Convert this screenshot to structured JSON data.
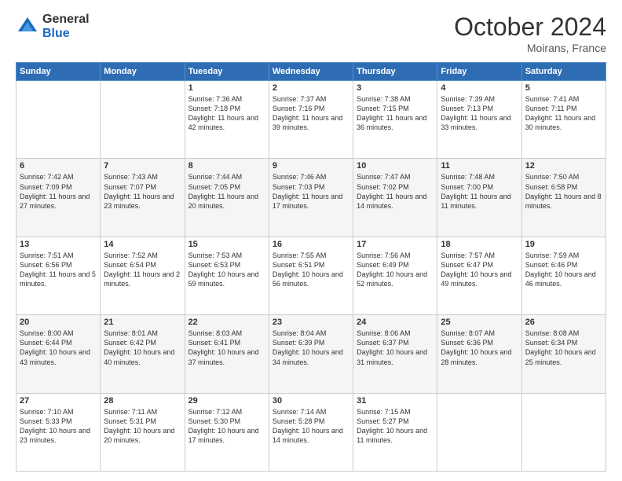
{
  "header": {
    "logo_general": "General",
    "logo_blue": "Blue",
    "month_title": "October 2024",
    "location": "Moirans, France"
  },
  "days_of_week": [
    "Sunday",
    "Monday",
    "Tuesday",
    "Wednesday",
    "Thursday",
    "Friday",
    "Saturday"
  ],
  "weeks": [
    [
      {
        "day": "",
        "sunrise": "",
        "sunset": "",
        "daylight": ""
      },
      {
        "day": "",
        "sunrise": "",
        "sunset": "",
        "daylight": ""
      },
      {
        "day": "1",
        "sunrise": "Sunrise: 7:36 AM",
        "sunset": "Sunset: 7:18 PM",
        "daylight": "Daylight: 11 hours and 42 minutes."
      },
      {
        "day": "2",
        "sunrise": "Sunrise: 7:37 AM",
        "sunset": "Sunset: 7:16 PM",
        "daylight": "Daylight: 11 hours and 39 minutes."
      },
      {
        "day": "3",
        "sunrise": "Sunrise: 7:38 AM",
        "sunset": "Sunset: 7:15 PM",
        "daylight": "Daylight: 11 hours and 36 minutes."
      },
      {
        "day": "4",
        "sunrise": "Sunrise: 7:39 AM",
        "sunset": "Sunset: 7:13 PM",
        "daylight": "Daylight: 11 hours and 33 minutes."
      },
      {
        "day": "5",
        "sunrise": "Sunrise: 7:41 AM",
        "sunset": "Sunset: 7:11 PM",
        "daylight": "Daylight: 11 hours and 30 minutes."
      }
    ],
    [
      {
        "day": "6",
        "sunrise": "Sunrise: 7:42 AM",
        "sunset": "Sunset: 7:09 PM",
        "daylight": "Daylight: 11 hours and 27 minutes."
      },
      {
        "day": "7",
        "sunrise": "Sunrise: 7:43 AM",
        "sunset": "Sunset: 7:07 PM",
        "daylight": "Daylight: 11 hours and 23 minutes."
      },
      {
        "day": "8",
        "sunrise": "Sunrise: 7:44 AM",
        "sunset": "Sunset: 7:05 PM",
        "daylight": "Daylight: 11 hours and 20 minutes."
      },
      {
        "day": "9",
        "sunrise": "Sunrise: 7:46 AM",
        "sunset": "Sunset: 7:03 PM",
        "daylight": "Daylight: 11 hours and 17 minutes."
      },
      {
        "day": "10",
        "sunrise": "Sunrise: 7:47 AM",
        "sunset": "Sunset: 7:02 PM",
        "daylight": "Daylight: 11 hours and 14 minutes."
      },
      {
        "day": "11",
        "sunrise": "Sunrise: 7:48 AM",
        "sunset": "Sunset: 7:00 PM",
        "daylight": "Daylight: 11 hours and 11 minutes."
      },
      {
        "day": "12",
        "sunrise": "Sunrise: 7:50 AM",
        "sunset": "Sunset: 6:58 PM",
        "daylight": "Daylight: 11 hours and 8 minutes."
      }
    ],
    [
      {
        "day": "13",
        "sunrise": "Sunrise: 7:51 AM",
        "sunset": "Sunset: 6:56 PM",
        "daylight": "Daylight: 11 hours and 5 minutes."
      },
      {
        "day": "14",
        "sunrise": "Sunrise: 7:52 AM",
        "sunset": "Sunset: 6:54 PM",
        "daylight": "Daylight: 11 hours and 2 minutes."
      },
      {
        "day": "15",
        "sunrise": "Sunrise: 7:53 AM",
        "sunset": "Sunset: 6:53 PM",
        "daylight": "Daylight: 10 hours and 59 minutes."
      },
      {
        "day": "16",
        "sunrise": "Sunrise: 7:55 AM",
        "sunset": "Sunset: 6:51 PM",
        "daylight": "Daylight: 10 hours and 56 minutes."
      },
      {
        "day": "17",
        "sunrise": "Sunrise: 7:56 AM",
        "sunset": "Sunset: 6:49 PM",
        "daylight": "Daylight: 10 hours and 52 minutes."
      },
      {
        "day": "18",
        "sunrise": "Sunrise: 7:57 AM",
        "sunset": "Sunset: 6:47 PM",
        "daylight": "Daylight: 10 hours and 49 minutes."
      },
      {
        "day": "19",
        "sunrise": "Sunrise: 7:59 AM",
        "sunset": "Sunset: 6:46 PM",
        "daylight": "Daylight: 10 hours and 46 minutes."
      }
    ],
    [
      {
        "day": "20",
        "sunrise": "Sunrise: 8:00 AM",
        "sunset": "Sunset: 6:44 PM",
        "daylight": "Daylight: 10 hours and 43 minutes."
      },
      {
        "day": "21",
        "sunrise": "Sunrise: 8:01 AM",
        "sunset": "Sunset: 6:42 PM",
        "daylight": "Daylight: 10 hours and 40 minutes."
      },
      {
        "day": "22",
        "sunrise": "Sunrise: 8:03 AM",
        "sunset": "Sunset: 6:41 PM",
        "daylight": "Daylight: 10 hours and 37 minutes."
      },
      {
        "day": "23",
        "sunrise": "Sunrise: 8:04 AM",
        "sunset": "Sunset: 6:39 PM",
        "daylight": "Daylight: 10 hours and 34 minutes."
      },
      {
        "day": "24",
        "sunrise": "Sunrise: 8:06 AM",
        "sunset": "Sunset: 6:37 PM",
        "daylight": "Daylight: 10 hours and 31 minutes."
      },
      {
        "day": "25",
        "sunrise": "Sunrise: 8:07 AM",
        "sunset": "Sunset: 6:36 PM",
        "daylight": "Daylight: 10 hours and 28 minutes."
      },
      {
        "day": "26",
        "sunrise": "Sunrise: 8:08 AM",
        "sunset": "Sunset: 6:34 PM",
        "daylight": "Daylight: 10 hours and 25 minutes."
      }
    ],
    [
      {
        "day": "27",
        "sunrise": "Sunrise: 7:10 AM",
        "sunset": "Sunset: 5:33 PM",
        "daylight": "Daylight: 10 hours and 23 minutes."
      },
      {
        "day": "28",
        "sunrise": "Sunrise: 7:11 AM",
        "sunset": "Sunset: 5:31 PM",
        "daylight": "Daylight: 10 hours and 20 minutes."
      },
      {
        "day": "29",
        "sunrise": "Sunrise: 7:12 AM",
        "sunset": "Sunset: 5:30 PM",
        "daylight": "Daylight: 10 hours and 17 minutes."
      },
      {
        "day": "30",
        "sunrise": "Sunrise: 7:14 AM",
        "sunset": "Sunset: 5:28 PM",
        "daylight": "Daylight: 10 hours and 14 minutes."
      },
      {
        "day": "31",
        "sunrise": "Sunrise: 7:15 AM",
        "sunset": "Sunset: 5:27 PM",
        "daylight": "Daylight: 10 hours and 11 minutes."
      },
      {
        "day": "",
        "sunrise": "",
        "sunset": "",
        "daylight": ""
      },
      {
        "day": "",
        "sunrise": "",
        "sunset": "",
        "daylight": ""
      }
    ]
  ]
}
